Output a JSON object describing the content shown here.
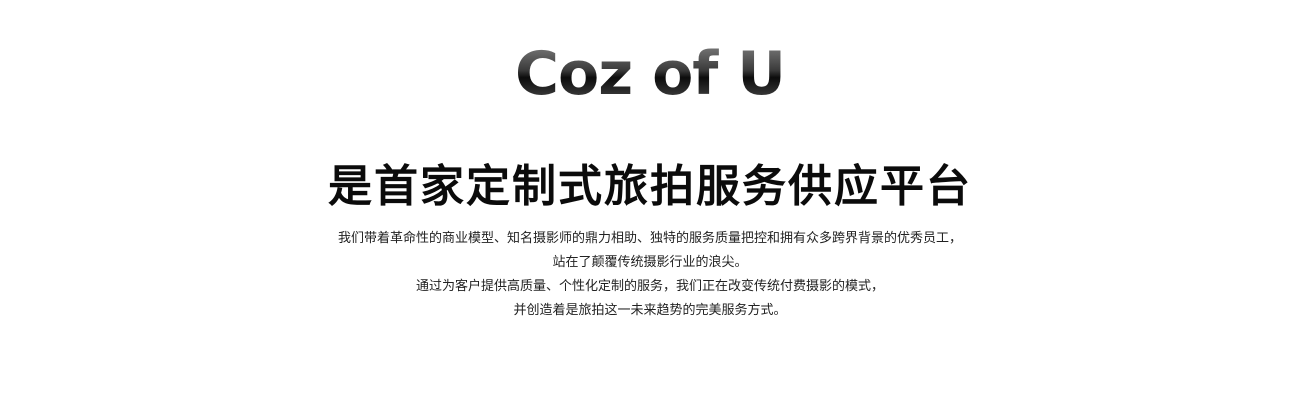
{
  "brand": {
    "logo_text": "Coz of U"
  },
  "headline": "是首家定制式旅拍服务供应平台",
  "description": {
    "lines": [
      "我们带着革命性的商业模型、知名摄影师的鼎力相助、独特的服务质量把控和拥有众多跨界背景的优秀员工，",
      "站在了颠覆传统摄影行业的浪尖。",
      "通过为客户提供高质量、个性化定制的服务，我们正在改变传统付费摄影的模式，",
      "并创造着是旅拍这一未来趋势的完美服务方式。"
    ]
  }
}
